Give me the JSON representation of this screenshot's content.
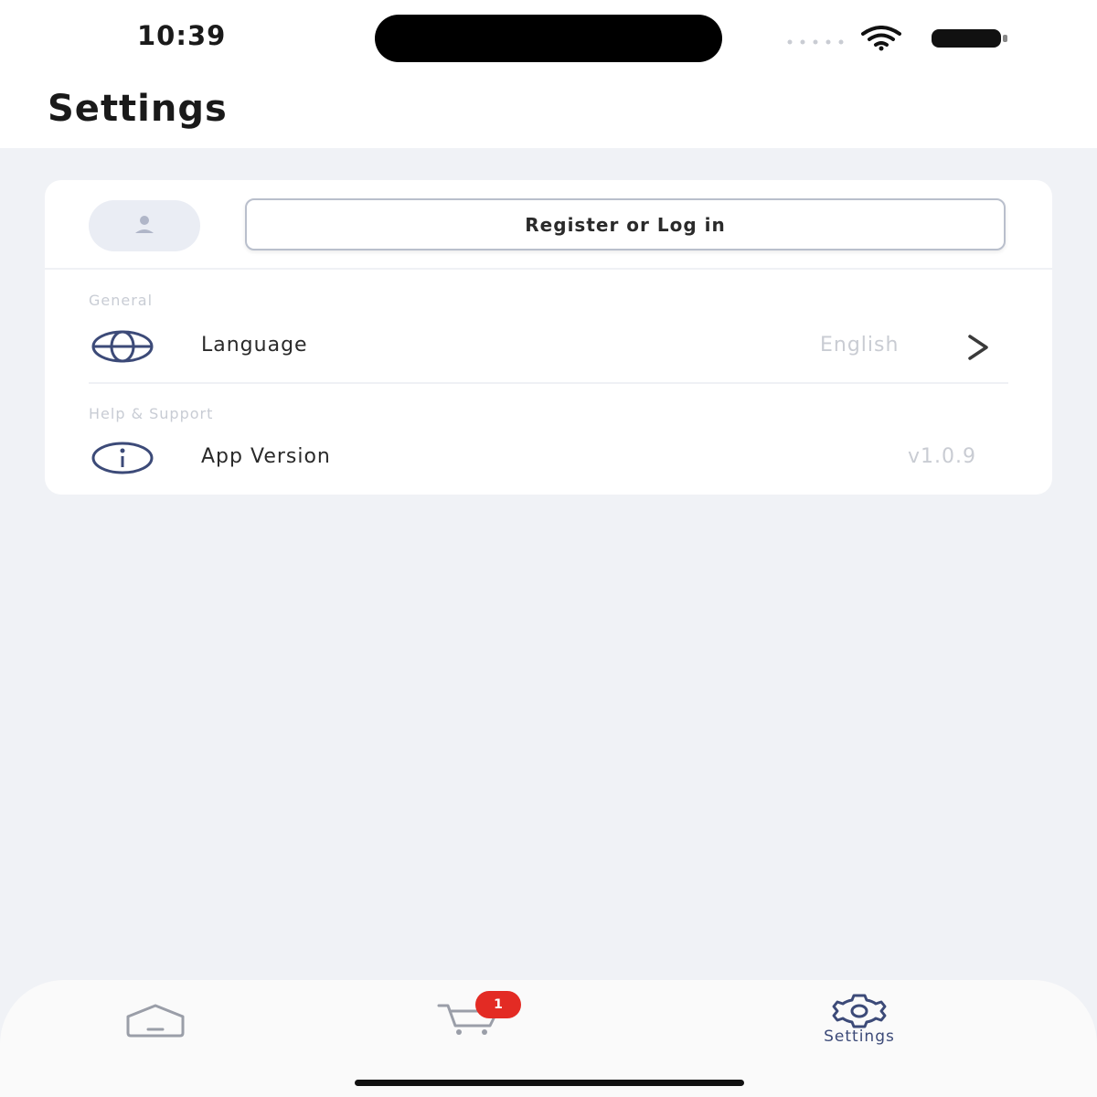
{
  "status_bar": {
    "time": "10:39"
  },
  "header": {
    "title": "Settings"
  },
  "account": {
    "avatar_icon": "user-icon",
    "login_label": "Register or Log in"
  },
  "sections": [
    {
      "label": "General",
      "rows": [
        {
          "icon": "globe-icon",
          "label": "Language",
          "value": "English",
          "chevron": "chevron-right-icon"
        }
      ]
    },
    {
      "label": "Help & Support",
      "rows": [
        {
          "icon": "info-icon",
          "label": "App Version",
          "value": "v1.0.9"
        }
      ]
    }
  ],
  "tabbar": {
    "tabs": [
      {
        "icon": "home-icon",
        "label": ""
      },
      {
        "icon": "cart-icon",
        "label": "",
        "badge": "1"
      },
      {
        "icon": "gear-icon",
        "label": "Settings",
        "active": true
      }
    ]
  },
  "colors": {
    "background": "#f0f2f6",
    "card": "#ffffff",
    "accent": "#3c4a78",
    "badge": "#e32b24",
    "muted_text": "#c9ccd3"
  }
}
